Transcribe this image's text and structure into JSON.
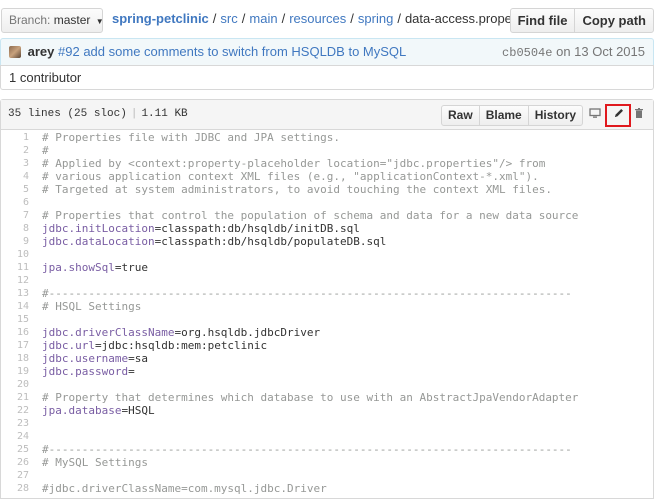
{
  "nav": {
    "branch_label": "Branch:",
    "branch_name": "master",
    "repo": "spring-petclinic",
    "path": [
      "src",
      "main",
      "resources",
      "spring"
    ],
    "file": "data-access.properties",
    "find_file": "Find file",
    "copy_path": "Copy path"
  },
  "commit": {
    "author": "arey",
    "issue": "#92",
    "message": "add some comments to switch from HSQLDB to MySQL",
    "sha": "cb0504e",
    "date_text": "on 13 Oct 2015"
  },
  "contributors": "1 contributor",
  "file": {
    "lines_info": "35 lines (25 sloc)",
    "size": "1.11 KB",
    "raw": "Raw",
    "blame": "Blame",
    "history": "History",
    "icons": [
      "desktop-icon",
      "pencil-icon",
      "trash-icon"
    ],
    "highlight_color": "#e0191e"
  },
  "code": [
    {
      "n": "1",
      "parts": [
        [
          "c",
          "# Properties file with JDBC and JPA settings."
        ]
      ]
    },
    {
      "n": "2",
      "parts": [
        [
          "c",
          "#"
        ]
      ]
    },
    {
      "n": "3",
      "parts": [
        [
          "c",
          "# Applied by <context:property-placeholder location=\"jdbc.properties\"/> from"
        ]
      ]
    },
    {
      "n": "4",
      "parts": [
        [
          "c",
          "# various application context XML files (e.g., \"applicationContext-*.xml\")."
        ]
      ]
    },
    {
      "n": "5",
      "parts": [
        [
          "c",
          "# Targeted at system administrators, to avoid touching the context XML files."
        ]
      ]
    },
    {
      "n": "6",
      "parts": []
    },
    {
      "n": "7",
      "parts": [
        [
          "c",
          "# Properties that control the population of schema and data for a new data source"
        ]
      ]
    },
    {
      "n": "8",
      "parts": [
        [
          "k",
          "jdbc.initLocation"
        ],
        [
          "p",
          "=classpath:db/hsqldb/initDB.sql"
        ]
      ]
    },
    {
      "n": "9",
      "parts": [
        [
          "k",
          "jdbc.dataLocation"
        ],
        [
          "p",
          "=classpath:db/hsqldb/populateDB.sql"
        ]
      ]
    },
    {
      "n": "10",
      "parts": []
    },
    {
      "n": "11",
      "parts": [
        [
          "k",
          "jpa.showSql"
        ],
        [
          "p",
          "=true"
        ]
      ]
    },
    {
      "n": "12",
      "parts": []
    },
    {
      "n": "13",
      "parts": [
        [
          "c",
          "#-------------------------------------------------------------------------------"
        ]
      ]
    },
    {
      "n": "14",
      "parts": [
        [
          "c",
          "# HSQL Settings"
        ]
      ]
    },
    {
      "n": "15",
      "parts": []
    },
    {
      "n": "16",
      "parts": [
        [
          "k",
          "jdbc.driverClassName"
        ],
        [
          "p",
          "=org.hsqldb.jdbcDriver"
        ]
      ]
    },
    {
      "n": "17",
      "parts": [
        [
          "k",
          "jdbc.url"
        ],
        [
          "p",
          "=jdbc:hsqldb:mem:petclinic"
        ]
      ]
    },
    {
      "n": "18",
      "parts": [
        [
          "k",
          "jdbc.username"
        ],
        [
          "p",
          "=sa"
        ]
      ]
    },
    {
      "n": "19",
      "parts": [
        [
          "k",
          "jdbc.password"
        ],
        [
          "p",
          "="
        ]
      ]
    },
    {
      "n": "20",
      "parts": []
    },
    {
      "n": "21",
      "parts": [
        [
          "c",
          "# Property that determines which database to use with an AbstractJpaVendorAdapter"
        ]
      ]
    },
    {
      "n": "22",
      "parts": [
        [
          "k",
          "jpa.database"
        ],
        [
          "p",
          "=HSQL"
        ]
      ]
    },
    {
      "n": "23",
      "parts": []
    },
    {
      "n": "24",
      "parts": []
    },
    {
      "n": "25",
      "parts": [
        [
          "c",
          "#-------------------------------------------------------------------------------"
        ]
      ]
    },
    {
      "n": "26",
      "parts": [
        [
          "c",
          "# MySQL Settings"
        ]
      ]
    },
    {
      "n": "27",
      "parts": []
    },
    {
      "n": "28",
      "parts": [
        [
          "c",
          "#jdbc.driverClassName=com.mysql.jdbc.Driver"
        ]
      ]
    }
  ]
}
